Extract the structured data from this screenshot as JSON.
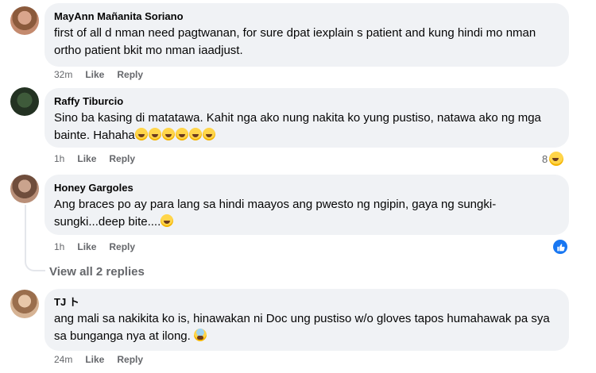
{
  "comments": [
    {
      "author": "MayAnn Mañanita Soriano",
      "text": "first of all d nman need pagtwanan, for sure dpat iexplain s patient and kung hindi mo nman ortho patient bkit mo nman iaadjust.",
      "time": "32m",
      "like_label": "Like",
      "reply_label": "Reply"
    },
    {
      "author": "Raffy Tiburcio",
      "text": "Sino ba kasing di matatawa. Kahit nga ako nung nakita ko yung pustiso, natawa ako ng mga bainte. Hahaha",
      "time": "1h",
      "like_label": "Like",
      "reply_label": "Reply",
      "reaction_count": "8"
    },
    {
      "author": "Honey Gargoles",
      "text": "Ang braces po ay para lang sa hindi maayos ang pwesto ng ngipin, gaya ng sungki-sungki...deep bite....",
      "time": "1h",
      "like_label": "Like",
      "reply_label": "Reply"
    },
    {
      "author": "TJ ト",
      "text": "ang mali sa nakikita ko is, hinawakan ni Doc ung pustiso w/o gloves tapos humahawak pa sya sa bunganga nya at ilong.",
      "time": "24m",
      "like_label": "Like",
      "reply_label": "Reply"
    }
  ],
  "view_all_replies": "View all 2 replies",
  "icons": {
    "laugh": "laughing-emoji-icon",
    "fear": "fearful-emoji-icon",
    "like": "like-reaction-icon"
  },
  "colors": {
    "bubble": "#f0f2f5",
    "meta": "#65676b",
    "like_blue": "#1877f2"
  }
}
